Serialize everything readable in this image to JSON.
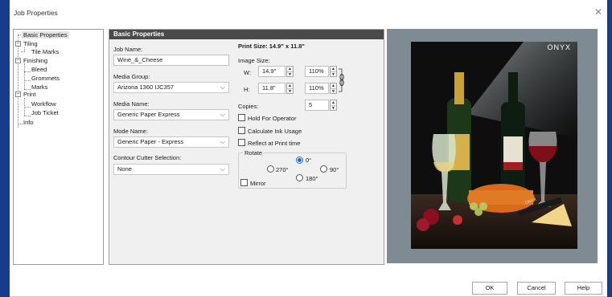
{
  "window": {
    "title": "Job Properties"
  },
  "tree": [
    {
      "label": "Basic Properties",
      "selected": true
    },
    {
      "label": "Tiling"
    },
    {
      "label": "Tile Marks"
    },
    {
      "label": "Finishing"
    },
    {
      "label": "Bleed"
    },
    {
      "label": "Grommets"
    },
    {
      "label": "Marks"
    },
    {
      "label": "Print"
    },
    {
      "label": "Workflow"
    },
    {
      "label": "Job Ticket"
    },
    {
      "label": "Info"
    }
  ],
  "panel": {
    "header": "Basic Properties",
    "job_name_label": "Job Name:",
    "job_name": "Wine_&_Cheese",
    "media_group_label": "Media Group:",
    "media_group": "Arizona 1360 IJC357",
    "media_name_label": "Media Name:",
    "media_name": "Generic Paper Express",
    "mode_name_label": "Mode Name:",
    "mode_name": "Generic Paper - Express",
    "contour_label": "Contour Cutter Selection:",
    "contour": "None",
    "print_size": "Print Size: 14.9\" x 11.8\"",
    "image_size_label": "Image Size:",
    "w_label": "W:",
    "w_value": "14.9\"",
    "w_percent": "110%",
    "h_label": "H:",
    "h_value": "11.8\"",
    "h_percent": "110%",
    "copies_label": "Copies:",
    "copies": "5",
    "hold_label": "Hold For Operator",
    "calc_label": "Calculate Ink Usage",
    "reflect_label": "Reflect at Print time",
    "rotate_label": "Rotate",
    "rot_0": "0°",
    "rot_90": "90°",
    "rot_180": "180°",
    "rot_270": "270°",
    "rotate_value": "0°",
    "mirror_label": "Mirror"
  },
  "preview": {
    "logo": "ONYX",
    "knife_text": "ONYX"
  },
  "buttons": {
    "ok": "OK",
    "cancel": "Cancel",
    "help": "Help"
  },
  "colors": {
    "frame": "#183c8c",
    "accent": "#1a6fd6",
    "header": "#4a4a4a"
  }
}
